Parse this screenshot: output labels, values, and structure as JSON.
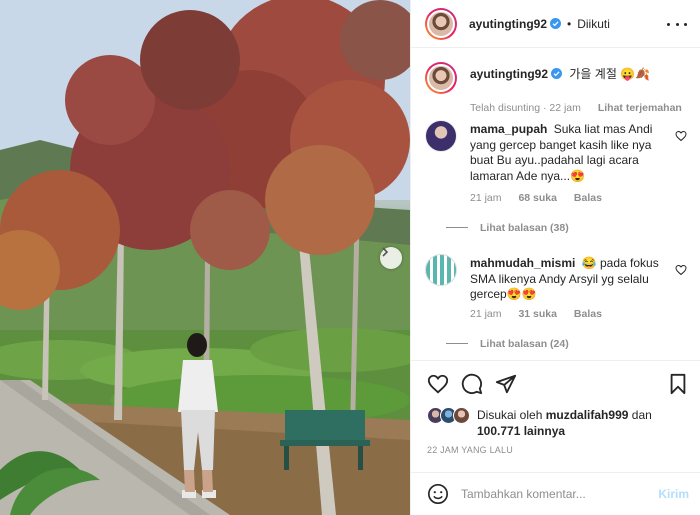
{
  "post": {
    "author": "ayutingting92",
    "follow_status": "Diikuti",
    "caption": "가을 계절 😛🍂",
    "caption_meta": "Telah disunting · 22 jam",
    "translate_label": "Lihat terjemahan"
  },
  "comments": [
    {
      "username": "mama_pupah",
      "text": "Suka liat mas Andi yang gercep banget kasih like nya buat Bu ayu..padahal lagi acara lamaran Ade nya...😍",
      "time": "21 jam",
      "likes": "68 suka",
      "reply_label": "Balas",
      "view_replies": "Lihat balasan (38)"
    },
    {
      "username": "mahmudah_mismi",
      "text": "😂 pada fokus SMA likenya Andy Arsyil yg selalu gercep😍😍",
      "time": "21 jam",
      "likes": "31 suka",
      "reply_label": "Balas",
      "view_replies": "Lihat balasan (24)"
    }
  ],
  "likes": {
    "prefix": "Disukai oleh",
    "first_user": "muzdalifah999",
    "joiner": "dan",
    "count": "100.771 lainnya"
  },
  "timestamp": "22 JAM YANG LALU",
  "add_comment": {
    "placeholder": "Tambahkan komentar...",
    "post_label": "Kirim"
  },
  "icons": {
    "verified": "verified-badge-icon",
    "more": "more-options-icon",
    "like": "heart-icon",
    "comment": "comment-icon",
    "share": "share-icon",
    "save": "bookmark-icon",
    "emoji": "emoji-icon",
    "next": "chevron-right-icon"
  },
  "colors": {
    "verified": "#3897f0",
    "post_button": "#b2dffc",
    "muted_text": "#8e8e8e"
  }
}
